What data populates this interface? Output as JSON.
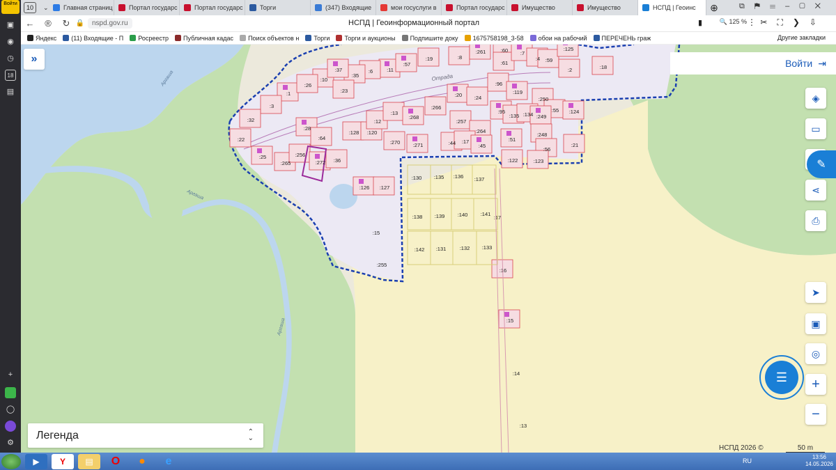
{
  "browser": {
    "tab_count": "10",
    "tabs": [
      {
        "label": "Главная страниц",
        "color": "#2c7be5"
      },
      {
        "label": "Портал государс",
        "color": "#c8102e"
      },
      {
        "label": "Портал государс",
        "color": "#c8102e"
      },
      {
        "label": "Торги",
        "color": "#2c5aa0"
      },
      {
        "label": "(347) Входящие",
        "color": "#3a7bd5"
      },
      {
        "label": "мои госуслуги в",
        "color": "#e53935"
      },
      {
        "label": "Портал государс",
        "color": "#c8102e"
      },
      {
        "label": "Имущество",
        "color": "#c8102e"
      },
      {
        "label": "Имущество",
        "color": "#c8102e"
      },
      {
        "label": "НСПД | Геоинс",
        "color": "#1a7fd6",
        "active": true
      }
    ],
    "url": "nspd.gov.ru",
    "page_title": "НСПД | Геоинформационный портал",
    "zoom": "125 %",
    "yandex_logo_text": "Войти"
  },
  "bookmarks": [
    {
      "label": "Яндекс",
      "color": "#222"
    },
    {
      "label": "(11) Входящие - П",
      "color": "#2c5aa0"
    },
    {
      "label": "Росреестр",
      "color": "#2a9d4a"
    },
    {
      "label": "Публичная кадас",
      "color": "#8b2b2b"
    },
    {
      "label": "Поиск объектов н",
      "color": "#aaa"
    },
    {
      "label": "Торги",
      "color": "#2c5aa0"
    },
    {
      "label": "Торги и аукционы",
      "color": "#b03030"
    },
    {
      "label": "Подпишите доку",
      "color": "#777"
    },
    {
      "label": "1675758198_3-58",
      "color": "#e6a100"
    },
    {
      "label": "обои на рабочий",
      "color": "#7a6ad8"
    },
    {
      "label": "ПЕРЕЧЕНЬ граж",
      "color": "#2c5aa0"
    }
  ],
  "bookmarks_other": "Другие закладки",
  "map": {
    "login_label": "Войти",
    "legend_label": "Легенда",
    "attribution": "НСПД 2026 ©",
    "scale_label": "50 m",
    "street_label": "Отрада",
    "river_label": "Аргаша",
    "parcels": [
      ":1",
      ":3",
      ":10",
      ":11",
      ":6",
      ":35",
      ":57",
      ":19",
      ":8",
      ":261",
      ":60",
      ":61",
      ":7",
      ":4",
      ":59",
      ":125",
      ":2",
      ":18",
      ":37",
      ":26",
      ":23",
      ":20",
      ":24",
      ":96",
      ":119",
      ":250",
      ":55",
      ":124",
      ":32",
      ":22",
      ":28",
      ":64",
      ":128",
      ":120",
      ":12",
      ":13",
      ":268",
      ":266",
      ":257",
      ":95",
      ":135",
      ":134",
      ":249",
      ":264",
      ":248",
      ":51",
      ":56",
      ":21",
      ":25",
      ":265",
      ":256",
      ":272",
      ":36",
      ":270",
      ":271",
      ":44",
      ":17",
      ":45",
      ":122",
      ":123",
      ":126",
      ":127",
      ":130",
      ":135",
      ":136",
      ":137",
      ":138",
      ":139",
      ":140",
      ":141",
      ":17",
      ":15",
      ":142",
      ":131",
      ":132",
      ":133",
      ":255",
      ":16",
      ":15",
      ":14",
      ":13"
    ]
  },
  "taskbar": {
    "lang": "RU",
    "time": "13:56",
    "date": "14.05.2026"
  },
  "colors": {
    "water": "#bcd6ee",
    "forest": "#c3e0b0",
    "field": "#f7f1c8",
    "settlement": "#ece9f4",
    "parcel_fill": "#f6dde2",
    "parcel_stroke": "#d9454f",
    "building": "#cc55cc",
    "boundary": "#1a3fb0",
    "accent": "#1a5bb8"
  }
}
